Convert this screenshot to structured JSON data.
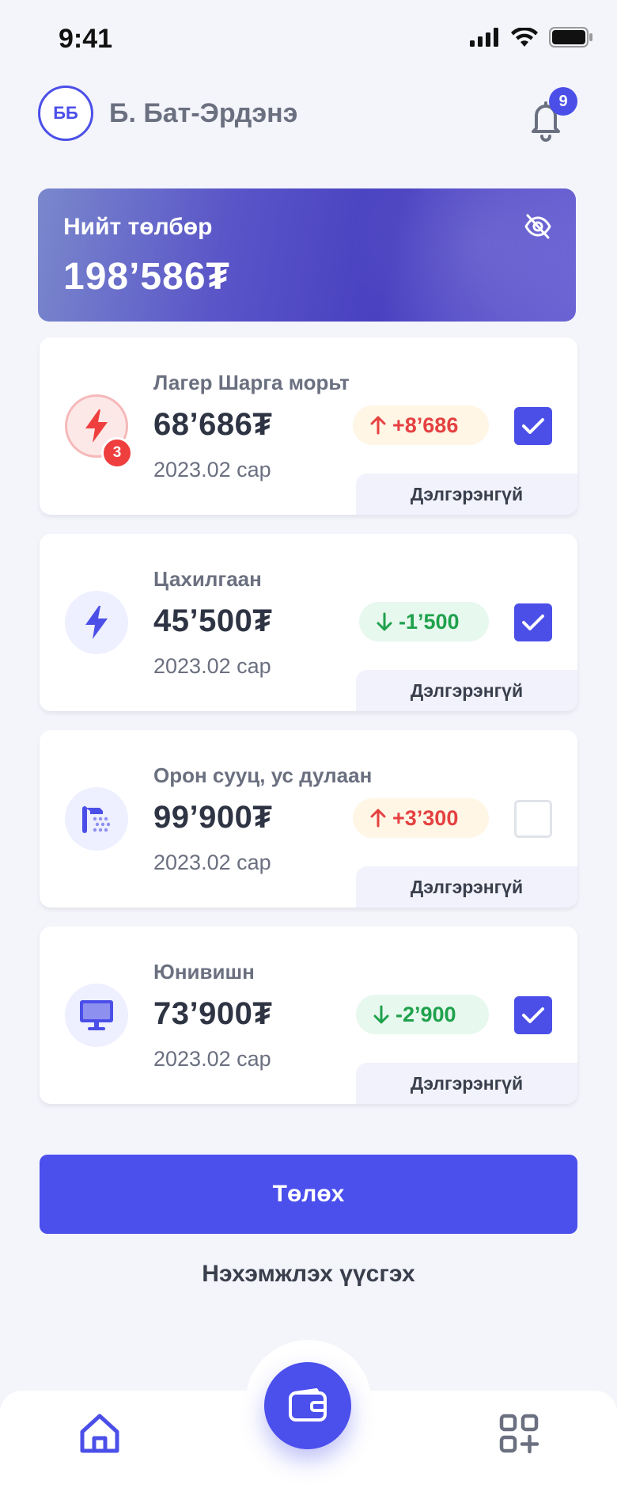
{
  "status_bar": {
    "time": "9:41"
  },
  "header": {
    "avatar_initials": "ББ",
    "user_name": "Б. Бат-Эрдэнэ",
    "notification_count": "9"
  },
  "total": {
    "label": "Нийт төлбөр",
    "amount": "198’586₮"
  },
  "bills": [
    {
      "name": "Лагер Шарга морьт",
      "amount": "68’686₮",
      "period": "2023.02 сар",
      "change": "+8’686",
      "change_dir": "up",
      "checked": true,
      "icon": "lightning-icon",
      "badge": "3",
      "detail_label": "Дэлгэрэнгүй"
    },
    {
      "name": "Цахилгаан",
      "amount": "45’500₮",
      "period": "2023.02 сар",
      "change": "-1’500",
      "change_dir": "down",
      "checked": true,
      "icon": "lightning-icon",
      "detail_label": "Дэлгэрэнгүй"
    },
    {
      "name": "Орон сууц, ус дулаан",
      "amount": "99’900₮",
      "period": "2023.02 сар",
      "change": "+3’300",
      "change_dir": "up",
      "checked": false,
      "icon": "shower-icon",
      "detail_label": "Дэлгэрэнгүй"
    },
    {
      "name": "Юнивишн",
      "amount": "73’900₮",
      "period": "2023.02 сар",
      "change": "-2’900",
      "change_dir": "down",
      "checked": true,
      "icon": "monitor-icon",
      "detail_label": "Дэлгэрэнгүй"
    }
  ],
  "actions": {
    "pay_label": "Төлөх",
    "invoice_label": "Нэхэмжлэх үүсгэх"
  },
  "tabbar": {
    "items": [
      "home-icon",
      "wallet-icon",
      "apps-add-icon"
    ]
  },
  "colors": {
    "accent": "#4b4fec",
    "up": "#e54141",
    "down": "#1fa14c"
  }
}
